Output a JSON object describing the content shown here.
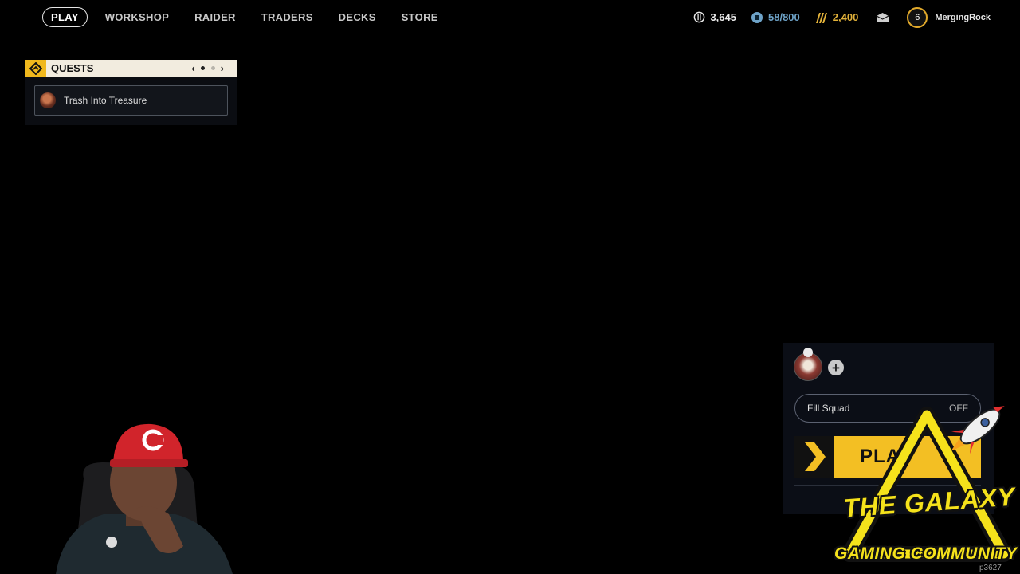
{
  "nav": {
    "items": [
      {
        "label": "PLAY",
        "active": true
      },
      {
        "label": "WORKSHOP"
      },
      {
        "label": "RAIDER"
      },
      {
        "label": "TRADERS"
      },
      {
        "label": "DECKS"
      },
      {
        "label": "STORE"
      }
    ]
  },
  "currency": {
    "coins": {
      "value": "3,645",
      "icon": "coins-icon"
    },
    "tickets": {
      "value": "58/800",
      "icon": "ticket-icon"
    },
    "gold": {
      "value": "2,400",
      "icon": "gold-icon"
    }
  },
  "player": {
    "level": "6",
    "username": "MergingRock"
  },
  "quests": {
    "title": "QUESTS",
    "items": [
      {
        "name": "Trash Into Treasure"
      }
    ]
  },
  "squad": {
    "fill_squad_label": "Fill Squad",
    "fill_squad_state": "OFF",
    "play_label": "PLAY"
  },
  "overlay": {
    "logo_line1": "THE GALAXY",
    "logo_line2": "GAMING COMMUNITY",
    "stream_id": "p3627"
  },
  "colors": {
    "accent_yellow": "#f3bf23",
    "background": "#000000",
    "logo_yellow": "#f5e21b"
  }
}
